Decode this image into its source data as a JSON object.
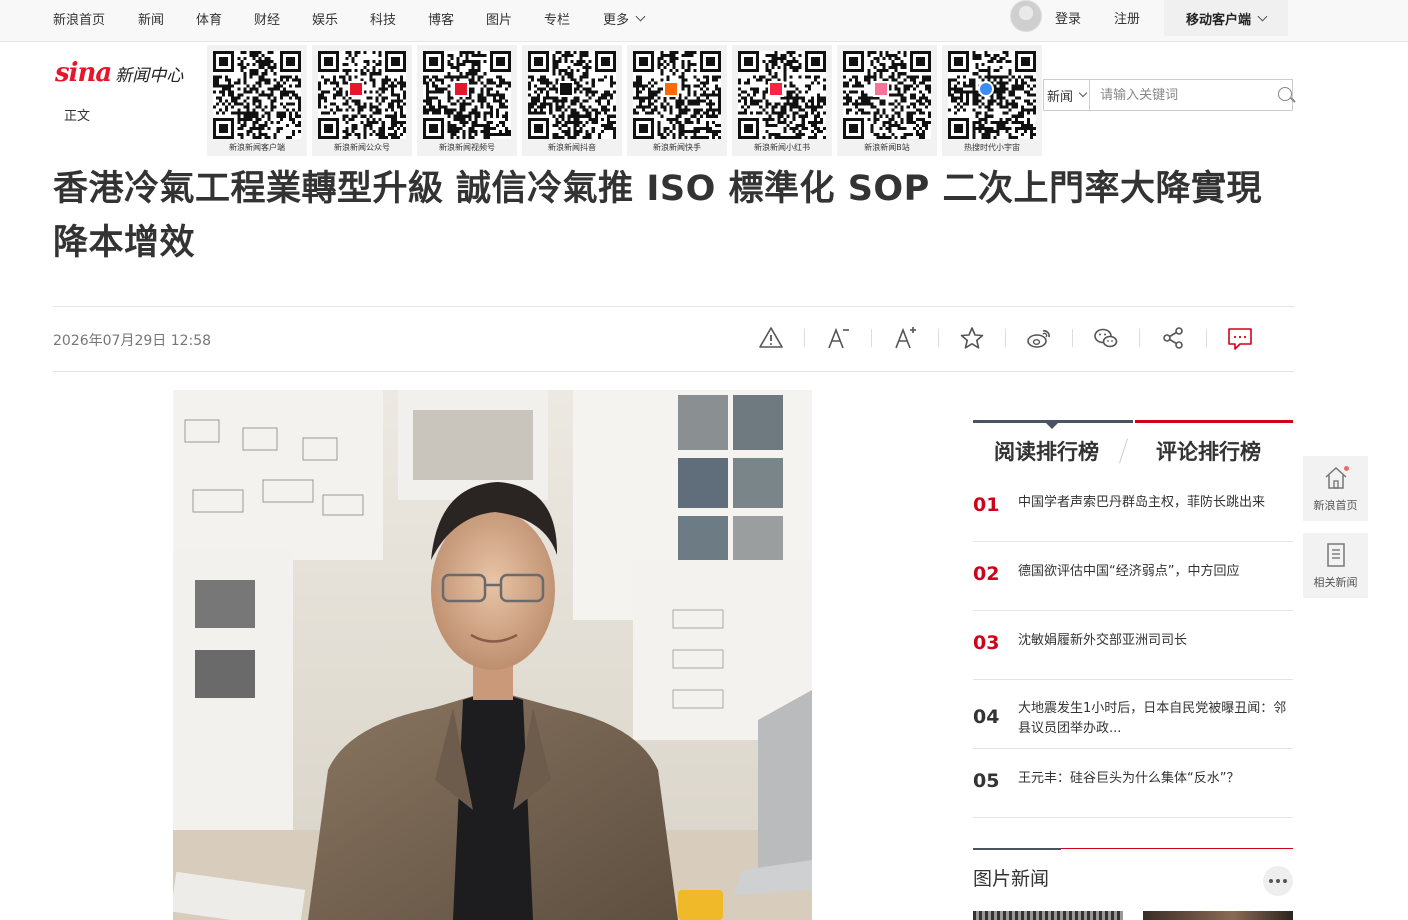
{
  "topnav": {
    "links": [
      "新浪首页",
      "新闻",
      "体育",
      "财经",
      "娱乐",
      "科技",
      "博客",
      "图片",
      "专栏"
    ],
    "more": "更多",
    "login": "登录",
    "register": "注册",
    "mobile_client": "移动客户端"
  },
  "header": {
    "logo_text": "sina",
    "logo_suffix": "新闻中心",
    "breadcrumb": "正文",
    "qr_codes": [
      {
        "label": "新浪新闻客户端",
        "icon": "none"
      },
      {
        "label": "新浪新闻公众号",
        "icon": "sina-logo"
      },
      {
        "label": "新浪新闻视频号",
        "icon": "sina-logo"
      },
      {
        "label": "新浪新闻抖音",
        "icon": "tiktok-icon"
      },
      {
        "label": "新浪新闻快手",
        "icon": "kuaishou-icon"
      },
      {
        "label": "新浪新闻小红书",
        "icon": "xiaohongshu-icon"
      },
      {
        "label": "新浪新闻B站",
        "icon": "bilibili-icon"
      },
      {
        "label": "热搜时代小宇宙",
        "icon": "xiaoyuzhou-icon"
      }
    ]
  },
  "search": {
    "category": "新闻",
    "placeholder": "请输入关键词"
  },
  "article": {
    "title": "香港冷氣工程業轉型升級 誠信冷氣推 ISO 標準化 SOP 二次上門率大降實現降本增效",
    "date": "2026年07月29日 12:58"
  },
  "toolbar": {
    "icons": [
      "report-icon",
      "font-smaller-icon",
      "font-larger-icon",
      "favorite-icon",
      "weibo-icon",
      "wechat-icon",
      "share-icon",
      "comment-icon"
    ]
  },
  "ranking": {
    "tab_read": "阅读排行榜",
    "tab_comment": "评论排行榜",
    "items": [
      {
        "num": "01",
        "text": "中国学者声索巴丹群岛主权，菲防长跳出来"
      },
      {
        "num": "02",
        "text": "德国欲评估中国“经济弱点”，中方回应"
      },
      {
        "num": "03",
        "text": "沈敏娟履新外交部亚洲司司长"
      },
      {
        "num": "04",
        "text": "大地震发生1小时后，日本自民党被曝丑闻：邻县议员团举办政..."
      },
      {
        "num": "05",
        "text": "王元丰：硅谷巨头为什么集体“反水”？"
      }
    ]
  },
  "photo_news": {
    "title": "图片新闻"
  },
  "float": {
    "home": "新浪首页",
    "related": "相关新闻"
  },
  "colors": {
    "accent_red": "#d0021b",
    "dark_bar": "#4b5260"
  }
}
